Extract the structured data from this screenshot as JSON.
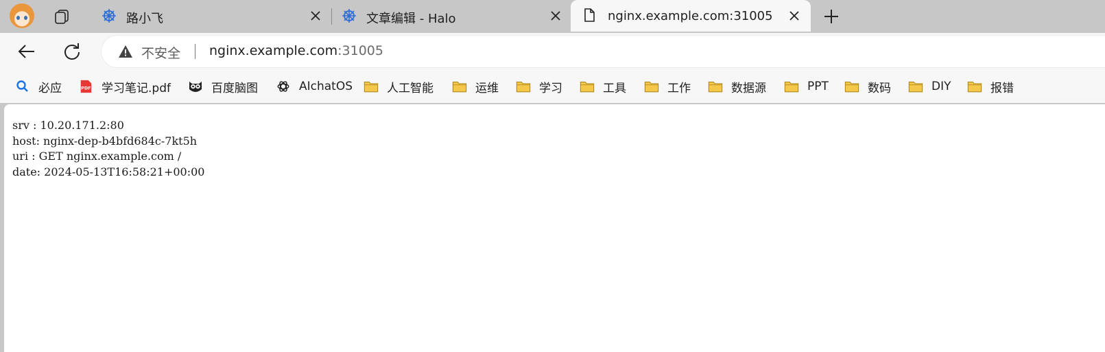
{
  "tabs": [
    {
      "title": "路小飞",
      "favicon": "kubernetes-helm-icon",
      "active": false
    },
    {
      "title": "文章编辑 - Halo",
      "favicon": "kubernetes-helm-icon",
      "active": false
    },
    {
      "title": "nginx.example.com:31005",
      "favicon": "document-icon",
      "active": true
    }
  ],
  "address_bar": {
    "security_text": "不安全",
    "url_host": "nginx.example.com",
    "url_port": ":31005"
  },
  "bookmarks": [
    {
      "label": "必应",
      "icon": "search-icon"
    },
    {
      "label": "学习笔记.pdf",
      "icon": "pdf-icon"
    },
    {
      "label": "百度脑图",
      "icon": "owl-icon"
    },
    {
      "label": "AIchatOS",
      "icon": "openai-icon"
    },
    {
      "label": "人工智能",
      "icon": "folder-icon"
    },
    {
      "label": "运维",
      "icon": "folder-icon"
    },
    {
      "label": "学习",
      "icon": "folder-icon"
    },
    {
      "label": "工具",
      "icon": "folder-icon"
    },
    {
      "label": "工作",
      "icon": "folder-icon"
    },
    {
      "label": "数据源",
      "icon": "folder-icon"
    },
    {
      "label": "PPT",
      "icon": "folder-icon"
    },
    {
      "label": "数码",
      "icon": "folder-icon"
    },
    {
      "label": "DIY",
      "icon": "folder-icon"
    },
    {
      "label": "报错",
      "icon": "folder-icon"
    }
  ],
  "page": {
    "lines": [
      "srv : 10.20.171.2:80",
      "host: nginx-dep-b4bfd684c-7kt5h",
      "uri : GET nginx.example.com /",
      "date: 2024-05-13T16:58:21+00:00"
    ]
  },
  "colors": {
    "folder": "#f5c84b",
    "folder_stroke": "#b08a20",
    "accent": "#0078d4"
  }
}
